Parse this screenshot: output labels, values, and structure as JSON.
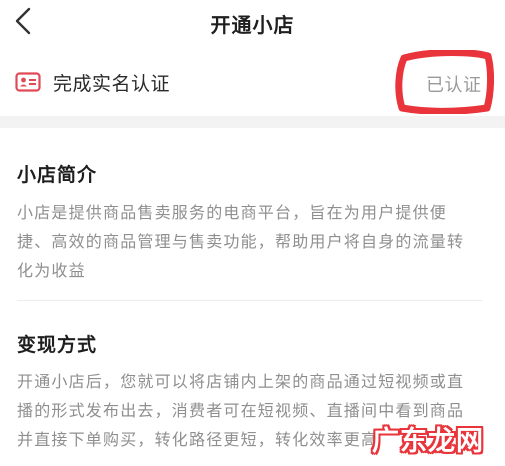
{
  "nav": {
    "title": "开通小店"
  },
  "verification": {
    "label": "完成实名认证",
    "status": "已认证"
  },
  "intro": {
    "title": "小店简介",
    "lines": [
      "小店是提供商品售卖服务的电商平台，旨在为用户提供便",
      "捷、高效的商品管理与售卖功能，帮助用户将自身的流量转",
      "化为收益"
    ]
  },
  "monetize": {
    "title": "变现方式",
    "lines": [
      "开通小店后，您就可以将店铺内上架的商品通过短视频或直",
      "播的形式发布出去，消费者可在短视频、直播间中看到商品",
      "并直接下单购买，转化路径更短，转化效率更高"
    ]
  },
  "watermark": {
    "text": "广东龙网"
  },
  "colors": {
    "accent_red": "#e8343a",
    "muted_text": "#8f8f8f",
    "separator": "#f3f3f3"
  }
}
